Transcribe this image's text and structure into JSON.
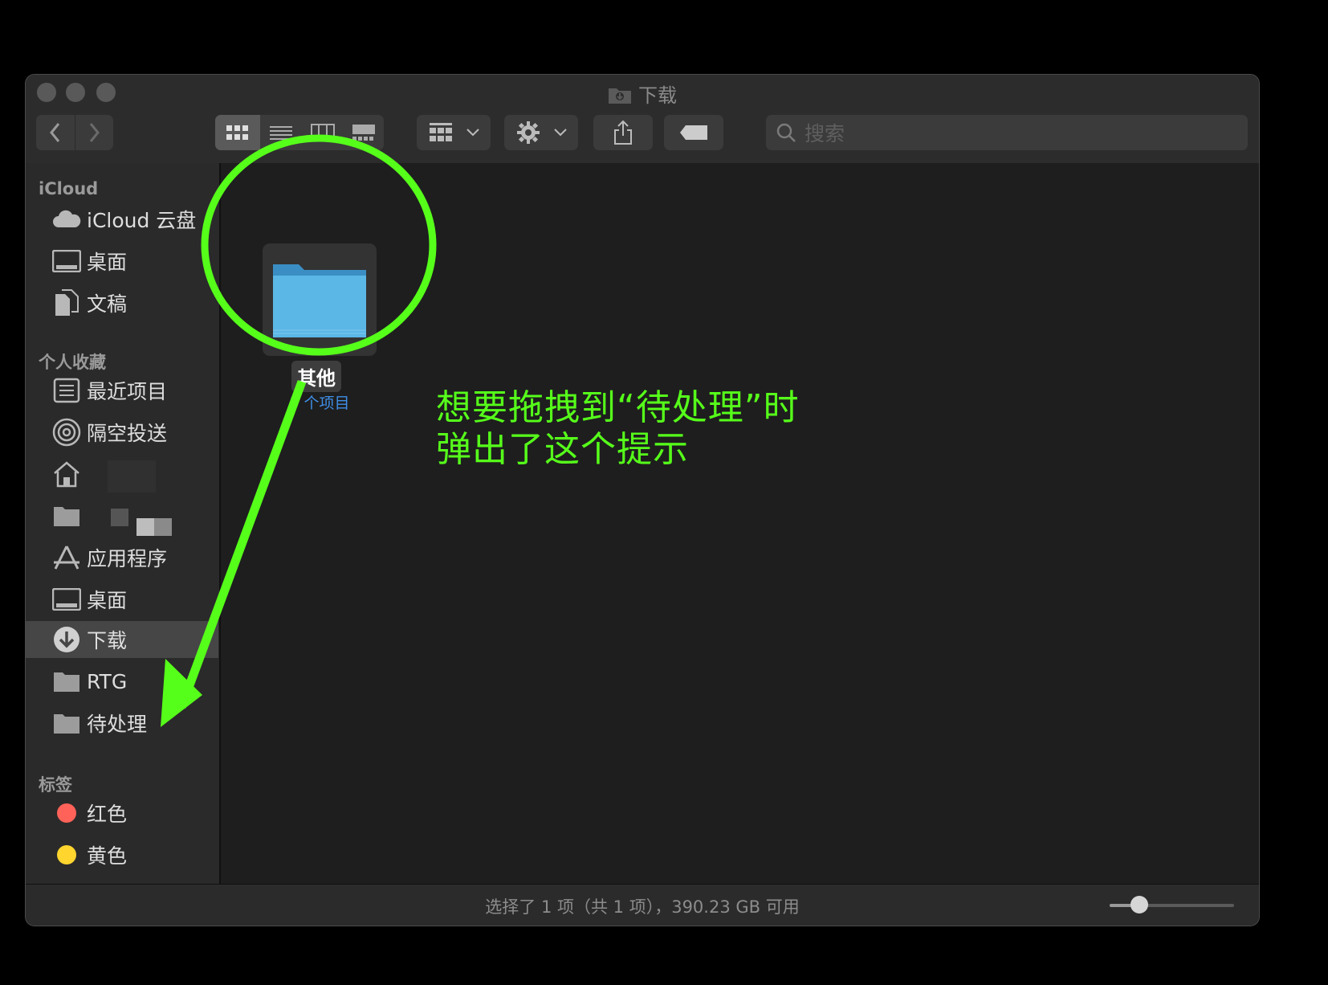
{
  "window": {
    "title": "下载"
  },
  "toolbar": {
    "back_icon": "chevron-left-icon",
    "forward_icon": "chevron-right-icon",
    "view_modes": [
      "icon-view",
      "list-view",
      "column-view",
      "gallery-view"
    ],
    "search_placeholder": "搜索"
  },
  "sidebar": {
    "sections": [
      {
        "label": "iCloud",
        "items": [
          {
            "label": "iCloud 云盘",
            "icon": "cloud-icon"
          },
          {
            "label": "桌面",
            "icon": "desktop-icon"
          },
          {
            "label": "文稿",
            "icon": "document-icon"
          }
        ]
      },
      {
        "label": "个人收藏",
        "items": [
          {
            "label": "最近项目",
            "icon": "recents-icon"
          },
          {
            "label": "隔空投送",
            "icon": "airdrop-icon"
          },
          {
            "label": "",
            "icon": "home-icon"
          },
          {
            "label": "",
            "icon": "folder-icon"
          },
          {
            "label": "应用程序",
            "icon": "applications-icon"
          },
          {
            "label": "桌面",
            "icon": "desktop-icon"
          },
          {
            "label": "下载",
            "icon": "download-icon",
            "selected": true
          },
          {
            "label": "RTG",
            "icon": "folder-icon"
          },
          {
            "label": "待处理",
            "icon": "folder-icon"
          }
        ]
      },
      {
        "label": "标签",
        "items": [
          {
            "label": "红色",
            "color": "#ff6259"
          },
          {
            "label": "黄色",
            "color": "#ffd52e"
          }
        ]
      }
    ]
  },
  "content": {
    "items": [
      {
        "name": "其他",
        "count": "5 个项目",
        "icon": "folder-icon"
      }
    ]
  },
  "status": {
    "text": "选择了 1 项（共 1 项），390.23 GB 可用",
    "zoom_level": 0.24
  },
  "annotation": {
    "line1": "想要拖拽到“待处理”时",
    "line2": "弹出了这个提示",
    "color": "#56ff1a"
  }
}
